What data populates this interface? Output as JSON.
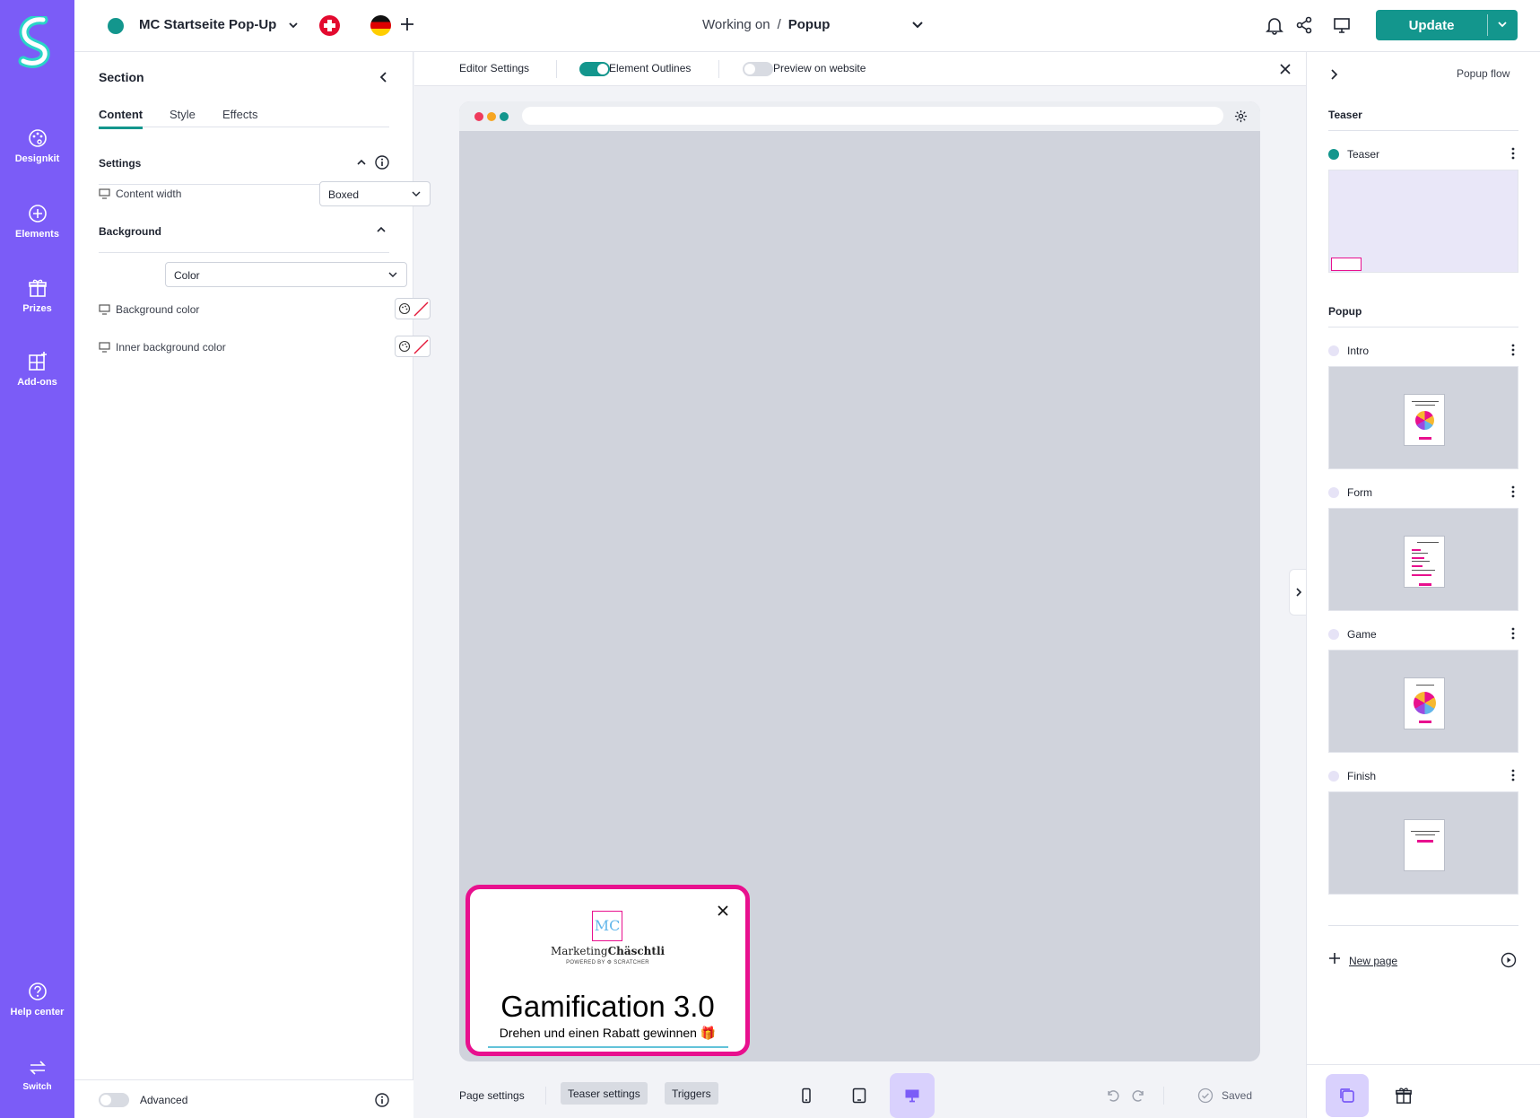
{
  "rail": {
    "items": [
      {
        "label": "Designkit",
        "icon": "palette-icon"
      },
      {
        "label": "Elements",
        "icon": "plus-circle-icon"
      },
      {
        "label": "Prizes",
        "icon": "gift-icon"
      },
      {
        "label": "Add-ons",
        "icon": "add-ons-icon"
      }
    ],
    "bottom": [
      {
        "label": "Help center",
        "icon": "help-icon"
      },
      {
        "label": "Switch",
        "icon": "switch-icon"
      }
    ]
  },
  "topbar": {
    "campaign_name": "MC Startseite Pop-Up",
    "working_on": "Working on",
    "separator": "/",
    "working_target": "Popup",
    "update_label": "Update"
  },
  "left_panel": {
    "title": "Section",
    "tabs": [
      "Content",
      "Style",
      "Effects"
    ],
    "active_tab": "Content",
    "settings": {
      "heading": "Settings",
      "content_width_label": "Content width",
      "content_width_value": "Boxed"
    },
    "background": {
      "heading": "Background",
      "type_value": "Color",
      "background_color_label": "Background color",
      "inner_background_color_label": "Inner background color"
    },
    "advanced_label": "Advanced"
  },
  "editor_bar": {
    "editor_settings": "Editor Settings",
    "element_outlines": "Element Outlines",
    "element_outlines_on": true,
    "preview_on_website": "Preview on website",
    "preview_on_website_on": false
  },
  "teaser": {
    "logo_text": "MC",
    "brand_prefix": "Marketing",
    "brand_bold": "Chäschtli",
    "powered_by": "POWERED BY ⚙ SCRATCHER",
    "title": "Gamification 3.0",
    "subtitle": "Drehen und einen Rabatt gewinnen 🎁"
  },
  "bottom_bar": {
    "page_settings": "Page settings",
    "teaser_settings": "Teaser settings",
    "triggers": "Triggers",
    "active_device": "desktop",
    "saved": "Saved"
  },
  "right_panel": {
    "title": "Popup flow",
    "groups": [
      {
        "name": "Teaser",
        "steps": [
          {
            "label": "Teaser",
            "active": true
          }
        ]
      },
      {
        "name": "Popup",
        "steps": [
          {
            "label": "Intro",
            "active": false
          },
          {
            "label": "Form",
            "active": false
          },
          {
            "label": "Game",
            "active": false
          },
          {
            "label": "Finish",
            "active": false
          }
        ]
      }
    ],
    "new_page": "New page"
  },
  "colors": {
    "accent_purple": "#7b5cf7",
    "accent_teal": "#13968d",
    "teaser_border": "#e8108e",
    "canvas_bg": "#d0d3dc"
  }
}
